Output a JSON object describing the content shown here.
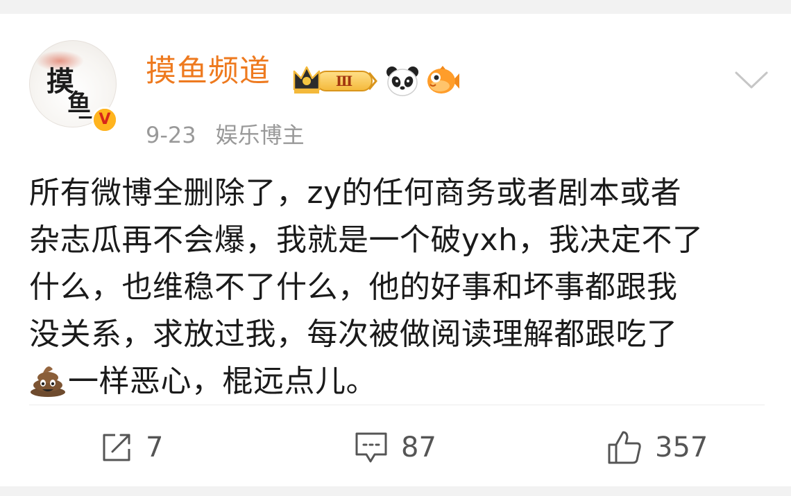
{
  "post": {
    "author": {
      "name": "摸鱼频道",
      "avatar_text": [
        "摸",
        "鱼",
        "一"
      ],
      "verified_badge": "V",
      "vip_level": "Ⅲ"
    },
    "date": "9-23",
    "category": "娱乐博主",
    "content_lines": [
      "所有微博全删除了，zy的任何商务或者剧本或者",
      "杂志瓜再不会爆，我就是一个破yxh，我决定不了",
      "什么，也维稳不了什么，他的好事和坏事都跟我",
      "没关系，求放过我，每次被做阅读理解都跟吃了",
      "一样恶心，棍远点儿。"
    ],
    "inline_emoji": "poop-emoji"
  },
  "actions": {
    "share_count": "7",
    "comment_count": "87",
    "like_count": "357"
  },
  "icons": {
    "vip": "crown-badge-icon",
    "emoji1": "panda-icon",
    "emoji2": "fish-icon",
    "menu": "chevron-down-icon",
    "share": "share-icon",
    "comment": "comment-icon",
    "like": "thumbs-up-icon"
  },
  "colors": {
    "username": "#ee7a1f",
    "meta": "#999999",
    "text": "#1a1a1a",
    "action": "#555555",
    "verified": "#f7a30b"
  }
}
